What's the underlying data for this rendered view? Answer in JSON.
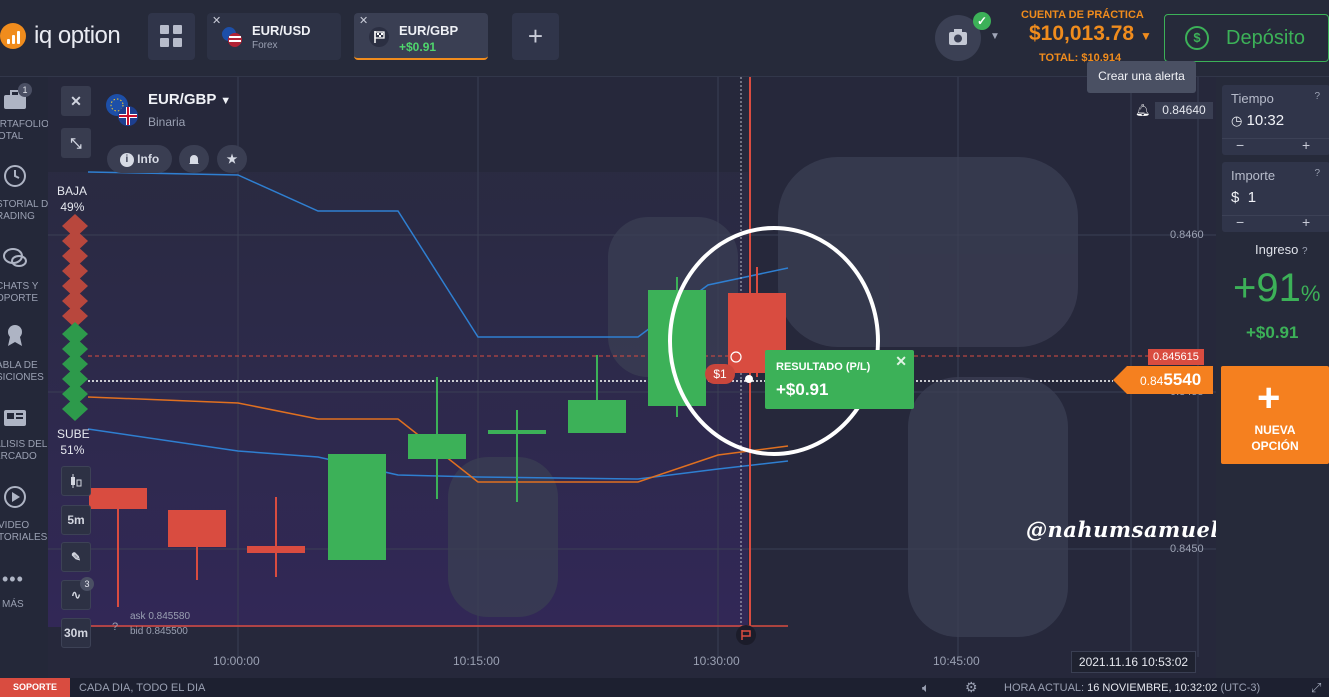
{
  "header": {
    "logo_text": "iq option",
    "tabs": [
      {
        "name": "EUR/USD",
        "sub": "Forex"
      },
      {
        "name": "EUR/GBP",
        "sub": "+$0.91"
      }
    ],
    "account_label": "CUENTA DE PRÁCTICA",
    "balance": "$10,013.78",
    "total": "TOTAL: $10,914",
    "deposit_label": "Depósito",
    "alert_tooltip": "Crear una alerta"
  },
  "sidebar": {
    "items": [
      {
        "label": "PORTAFOLIO\nTOTAL",
        "icon": "briefcase-icon",
        "badge": "1"
      },
      {
        "label": "HISTORIAL DE\nTRADING",
        "icon": "history-icon"
      },
      {
        "label": "CHATS Y\nSOPORTE",
        "icon": "chat-icon"
      },
      {
        "label": "TABLA DE\nPOSICIONES",
        "icon": "leaderboard-icon"
      },
      {
        "label": "ANÁLISIS DEL\nMERCADO",
        "icon": "news-icon"
      },
      {
        "label": "VIDEO\nTUTORIALES",
        "icon": "play-icon"
      },
      {
        "label": "MÁS",
        "icon": "more-icon"
      }
    ]
  },
  "chart": {
    "asset_name": "EUR/GBP",
    "asset_type": "Binaria",
    "info_label": "Info",
    "sell_label": "BAJA",
    "sell_pct": "49%",
    "buy_label": "SUBE",
    "buy_pct": "51%",
    "candle_interval": "5m",
    "indicator_count": "3",
    "timeframe": "30m",
    "ask": "ask 0.845580",
    "bid": "bid 0.845500",
    "alert_price": "0.84640",
    "strike_price": "0.845615",
    "current_price_small": "0.84",
    "current_price_big": "5540",
    "trade_tag": "$1",
    "result_title": "RESULTADO (P/L)",
    "result_value": "+$0.91",
    "watermark": "@nahumsamuel",
    "datetime": "2021.11.16 10:53:02"
  },
  "chart_data": {
    "type": "candlestick",
    "x": [
      "10:00:00",
      "10:15:00",
      "10:30:00",
      "10:45:00"
    ],
    "y_ticks": [
      "0.8460",
      "0.8455",
      "0.8450"
    ],
    "candles": [
      {
        "dir": "down"
      },
      {
        "dir": "down"
      },
      {
        "dir": "down"
      },
      {
        "dir": "up"
      },
      {
        "dir": "up"
      },
      {
        "dir": "up"
      },
      {
        "dir": "up"
      },
      {
        "dir": "up"
      },
      {
        "dir": "down"
      }
    ]
  },
  "trade_panel": {
    "time_label": "Tiempo",
    "time_value": "10:32",
    "amount_label": "Importe",
    "amount_value": "1",
    "currency": "$",
    "income_label": "Ingreso",
    "income_pct": "+91",
    "income_amount": "+$0.91",
    "new_option_label": "NUEVA OPCIÓN"
  },
  "statusbar": {
    "support": "SOPORTE",
    "schedule": "CADA DIA, TODO EL DIA",
    "current_time_label": "HORA ACTUAL:",
    "current_time": "16 NOVIEMBRE, 10:32:02",
    "timezone": "(UTC-3)"
  },
  "colors": {
    "brand": "#f08c1d",
    "green": "#3cb158",
    "red": "#d94c40"
  }
}
